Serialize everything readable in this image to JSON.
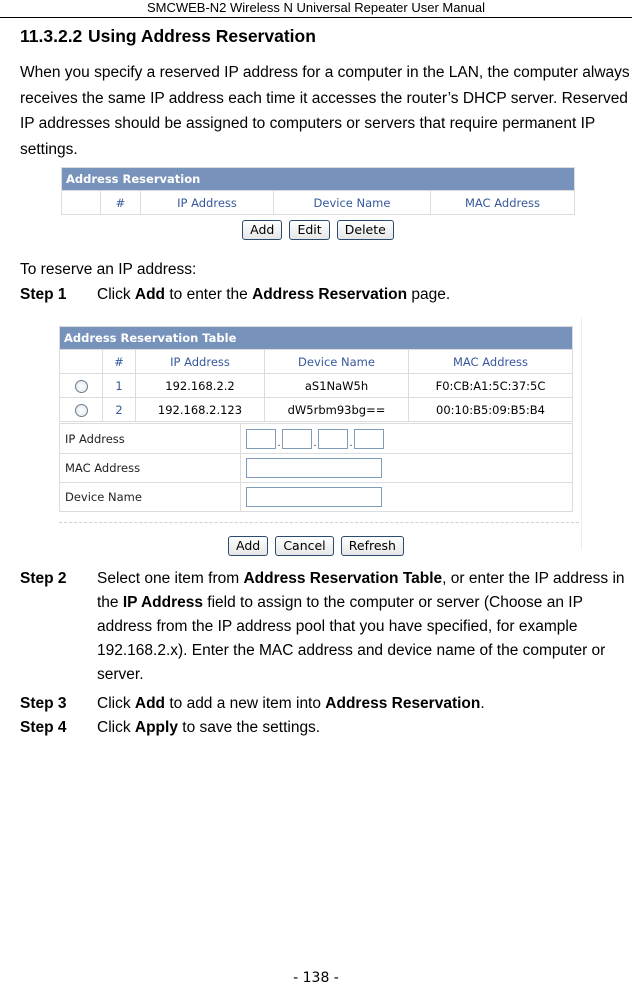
{
  "header": {
    "title": "SMCWEB-N2 Wireless N Universal Repeater User Manual"
  },
  "section": {
    "number": "11.3.2.2",
    "title": "Using Address Reservation"
  },
  "intro": "When you specify a reserved IP address for a computer in the LAN, the computer always receives the same IP address each time it accesses the router’s DHCP server. Reserved IP addresses should be assigned to computers or servers that require permanent IP settings.",
  "figure1": {
    "title": "Address Reservation",
    "columns": [
      "",
      "#",
      "IP Address",
      "Device Name",
      "MAC Address"
    ],
    "buttons": [
      "Add",
      "Edit",
      "Delete"
    ]
  },
  "instruction": "To reserve an IP address:",
  "step1": {
    "label": "Step 1",
    "pre": "Click ",
    "b1": "Add",
    "mid": " to enter the ",
    "b2": "Address Reservation",
    "post": " page."
  },
  "figure2": {
    "title": "Address Reservation Table",
    "columns": [
      "",
      "#",
      "IP Address",
      "Device Name",
      "MAC Address"
    ],
    "rows": [
      {
        "num": "1",
        "ip": "192.168.2.2",
        "name": "aS1NaW5h",
        "mac": "F0:CB:A1:5C:37:5C"
      },
      {
        "num": "2",
        "ip": "192.168.2.123",
        "name": "dW5rbm93bg==",
        "mac": "00:10:B5:09:B5:B4"
      }
    ],
    "form": {
      "ip_label": "IP Address",
      "ip_dot": ".",
      "mac_label": "MAC Address",
      "mac_value": "",
      "name_label": "Device Name",
      "name_value": ""
    },
    "buttons": [
      "Add",
      "Cancel",
      "Refresh"
    ]
  },
  "step2": {
    "label": "Step 2",
    "pre": "Select one item from ",
    "b1": "Address Reservation Table",
    "mid": ", or enter the IP address in the ",
    "b2": "IP Address",
    "post": " field to assign to the computer or server (Choose an IP address from the IP address pool that you have specified, for example 192.168.2.x). Enter the MAC address and device name of the computer or server."
  },
  "step3": {
    "label": "Step 3",
    "pre": "Click ",
    "b1": "Add",
    "mid": " to add a new item into ",
    "b2": "Address Reservation",
    "post": "."
  },
  "step4": {
    "label": "Step 4",
    "pre": "Click ",
    "b1": "Apply",
    "post": " to save the settings."
  },
  "page_number": "- 138 -"
}
